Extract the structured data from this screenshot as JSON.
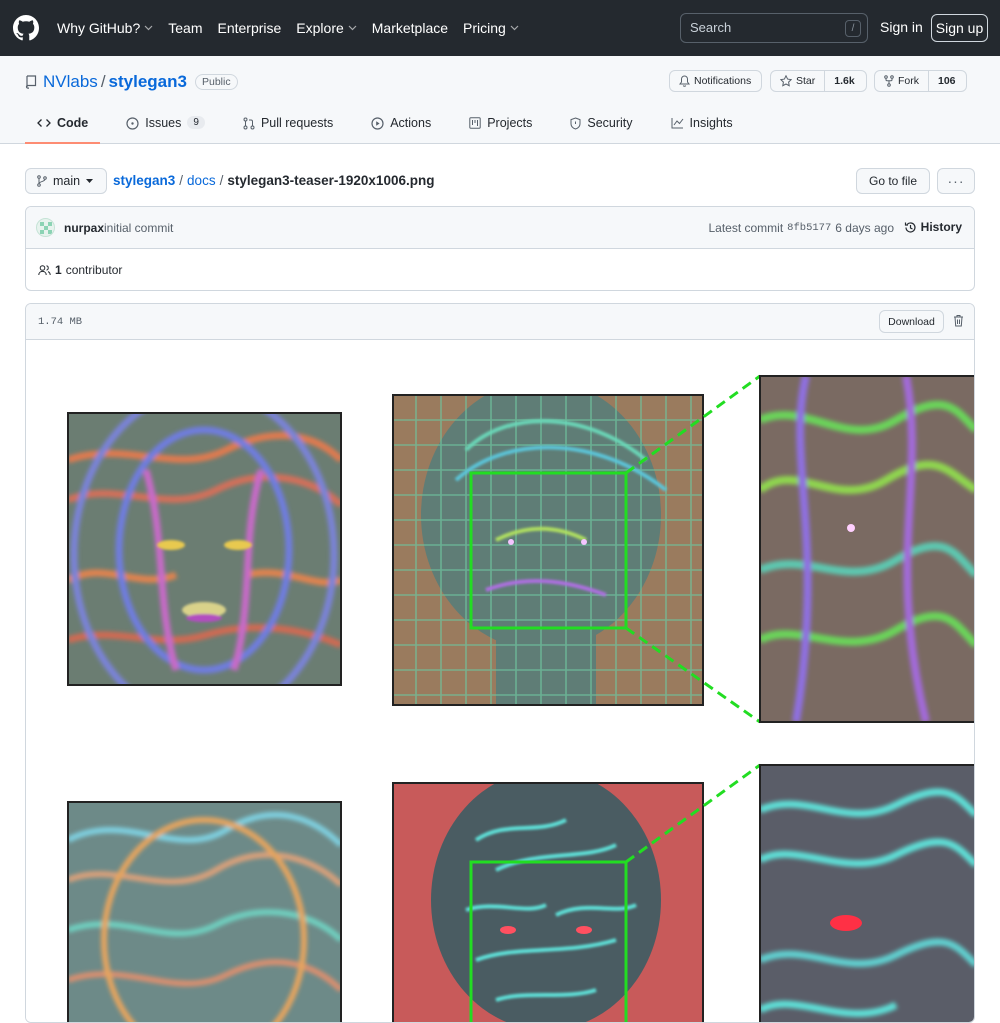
{
  "topnav": {
    "items": [
      "Why GitHub?",
      "Team",
      "Enterprise",
      "Explore",
      "Marketplace",
      "Pricing"
    ],
    "search_placeholder": "Search",
    "search_shortcut": "/",
    "signin": "Sign in",
    "signup": "Sign up"
  },
  "repo": {
    "owner": "NVlabs",
    "name": "stylegan3",
    "visibility": "Public",
    "notifications_label": "Notifications",
    "star_label": "Star",
    "star_count": "1.6k",
    "fork_label": "Fork",
    "fork_count": "106"
  },
  "tabs": [
    {
      "label": "Code",
      "icon": "code-icon"
    },
    {
      "label": "Issues",
      "icon": "issue-icon",
      "count": "9"
    },
    {
      "label": "Pull requests",
      "icon": "pull-request-icon"
    },
    {
      "label": "Actions",
      "icon": "play-icon"
    },
    {
      "label": "Projects",
      "icon": "project-icon"
    },
    {
      "label": "Security",
      "icon": "shield-icon"
    },
    {
      "label": "Insights",
      "icon": "graph-icon"
    }
  ],
  "filenav": {
    "branch": "main",
    "crumbs": [
      "stylegan3",
      "docs",
      "stylegan3-teaser-1920x1006.png"
    ],
    "separator": "/",
    "goto_file": "Go to file",
    "more": "···"
  },
  "commit": {
    "author": "nurpax",
    "message": "initial commit",
    "latest_label": "Latest commit",
    "sha": "8fb5177",
    "age": "6 days ago",
    "history": "History",
    "contributors_count": "1",
    "contributors_label": "contributor"
  },
  "file": {
    "size": "1.74 MB",
    "download": "Download"
  },
  "colors": {
    "header_bg": "#24292f",
    "link": "#0969da",
    "tab_underline": "#fd8c73",
    "highlight_box": "#22dd22"
  }
}
